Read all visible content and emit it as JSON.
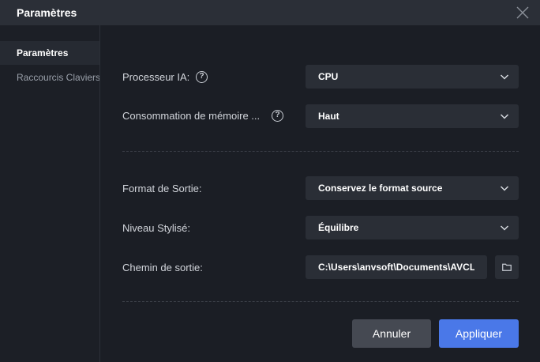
{
  "window": {
    "title": "Paramètres"
  },
  "sidebar": {
    "items": [
      {
        "label": "Paramètres",
        "active": true
      },
      {
        "label": "Raccourcis Claviers",
        "active": false
      }
    ]
  },
  "settings": {
    "ai_processor": {
      "label": "Processeur IA:",
      "value": "CPU",
      "help": "?"
    },
    "memory": {
      "label": "Consommation de mémoire ...",
      "value": "Haut",
      "help": "?"
    },
    "output_format": {
      "label": "Format de Sortie:",
      "value": "Conservez le format source"
    },
    "style_level": {
      "label": "Niveau Stylisé:",
      "value": "Équilibre"
    },
    "output_path": {
      "label": "Chemin de sortie:",
      "value": "C:\\Users\\anvsoft\\Documents\\AVCLabs"
    }
  },
  "actions": {
    "cancel": "Annuler",
    "apply": "Appliquer"
  },
  "colors": {
    "accent": "#4a78e8",
    "background": "#1b1e25",
    "field": "#2a2e36"
  },
  "icons": [
    "close-icon",
    "help-icon",
    "chevron-down-icon",
    "folder-icon"
  ]
}
